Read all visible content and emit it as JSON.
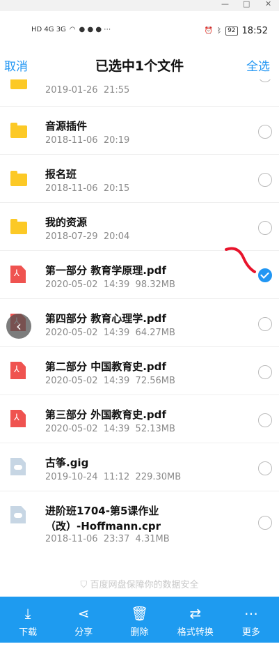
{
  "window": {
    "minimize": "—",
    "maximize": "□",
    "close": "✕"
  },
  "status": {
    "network": "HD 4G 3G",
    "battery": "92",
    "time": "18:52"
  },
  "header": {
    "cancel": "取消",
    "title": "已选中1个文件",
    "select_all": "全选"
  },
  "files": [
    {
      "type": "folder",
      "name": "",
      "meta": "2019-01-26  21:55",
      "selected": false
    },
    {
      "type": "folder",
      "name": "音源插件",
      "meta": "2018-11-06  20:19",
      "selected": false
    },
    {
      "type": "folder",
      "name": "报名班",
      "meta": "2018-11-06  20:15",
      "selected": false
    },
    {
      "type": "folder",
      "name": "我的资源",
      "meta": "2018-07-29  20:04",
      "selected": false
    },
    {
      "type": "pdf",
      "name": "第一部分 教育学原理.pdf",
      "meta": "2020-05-02  14:39  98.32MB",
      "selected": true
    },
    {
      "type": "pdf",
      "name": "第四部分 教育心理学.pdf",
      "meta": "2020-05-02  14:39  64.27MB",
      "selected": false
    },
    {
      "type": "pdf",
      "name": "第二部分 中国教育史.pdf",
      "meta": "2020-05-02  14:39  72.56MB",
      "selected": false
    },
    {
      "type": "pdf",
      "name": "第三部分 外国教育史.pdf",
      "meta": "2020-05-02  14:39  52.13MB",
      "selected": false
    },
    {
      "type": "other",
      "name": "古筝.gig",
      "meta": "2019-10-24  11:12  229.30MB",
      "selected": false
    },
    {
      "type": "other",
      "name": "进阶班1704-第5课作业",
      "name2": "（改）-Hoffmann.cpr",
      "meta": "2018-11-06  23:37  4.31MB",
      "selected": false
    }
  ],
  "footer_note": "百度网盘保障你的数据安全",
  "actions": [
    {
      "label": "下载",
      "icon": "download-icon"
    },
    {
      "label": "分享",
      "icon": "share-icon"
    },
    {
      "label": "删除",
      "icon": "trash-icon"
    },
    {
      "label": "格式转换",
      "icon": "convert-icon"
    },
    {
      "label": "更多",
      "icon": "more-icon"
    }
  ],
  "colors": {
    "accent": "#2196f3",
    "bottom_bar": "#1e9bf0",
    "folder": "#fcc926",
    "pdf": "#ef5350"
  }
}
